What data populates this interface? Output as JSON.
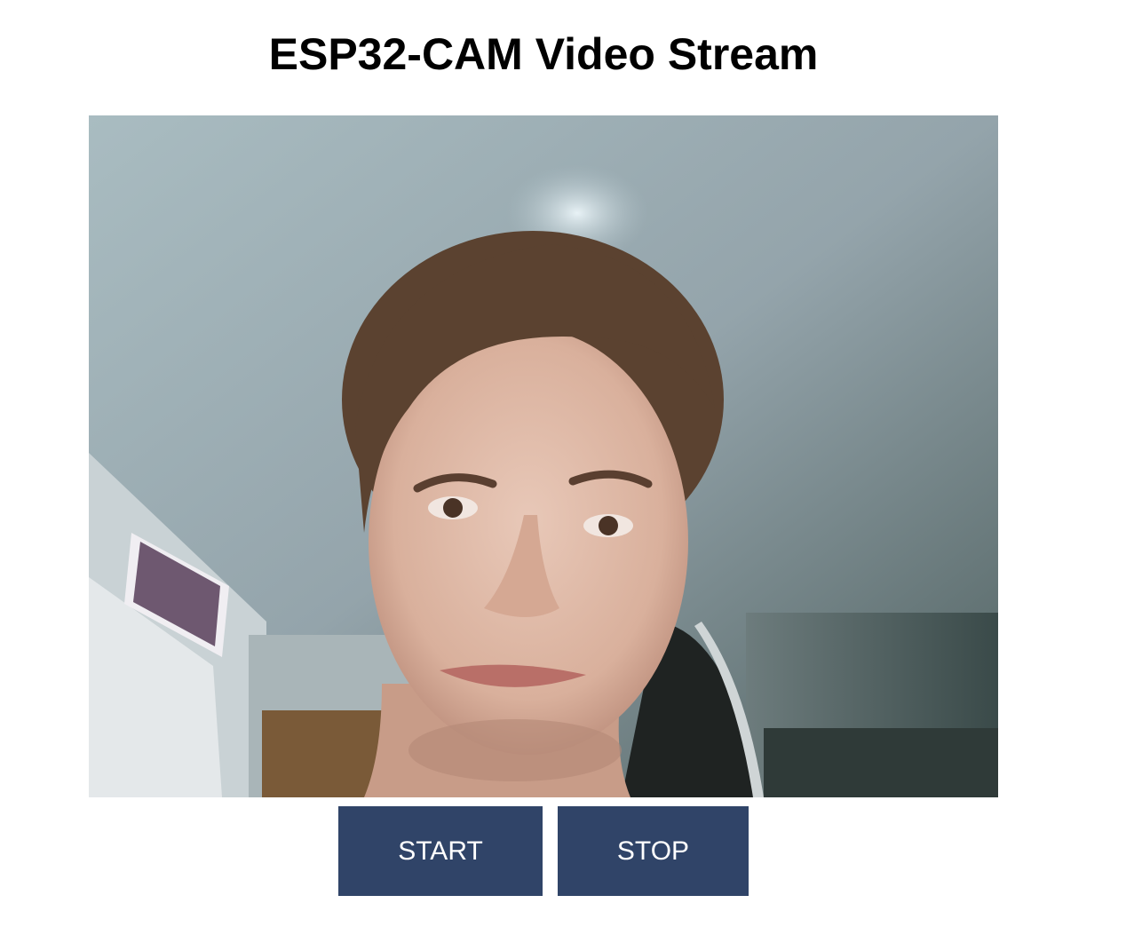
{
  "page": {
    "title": "ESP32-CAM Video Stream"
  },
  "stream": {
    "description_icon": "video-frame"
  },
  "controls": {
    "start_label": "START",
    "stop_label": "STOP"
  },
  "colors": {
    "button_bg": "#304468",
    "button_text": "#ffffff",
    "title_text": "#000000",
    "page_bg": "#ffffff"
  }
}
